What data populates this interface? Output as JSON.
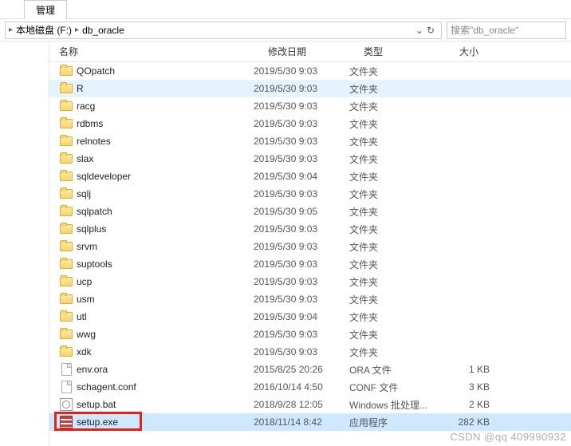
{
  "tab": {
    "label": "管理"
  },
  "breadcrumb": {
    "drive": "本地磁盘 (F:)",
    "folder": "db_oracle"
  },
  "search": {
    "placeholder": "搜索\"db_oracle\""
  },
  "columns": {
    "name": "名称",
    "date": "修改日期",
    "type": "类型",
    "size": "大小"
  },
  "types": {
    "folder": "文件夹",
    "ora": "ORA 文件",
    "conf": "CONF 文件",
    "bat": "Windows 批处理...",
    "exe": "应用程序"
  },
  "files": [
    {
      "icon": "folder",
      "name": "QOpatch",
      "date": "2019/5/30 9:03",
      "type": "文件夹",
      "size": ""
    },
    {
      "icon": "folder",
      "name": "R",
      "date": "2019/5/30 9:03",
      "type": "文件夹",
      "size": "",
      "hover": true
    },
    {
      "icon": "folder",
      "name": "racg",
      "date": "2019/5/30 9:03",
      "type": "文件夹",
      "size": ""
    },
    {
      "icon": "folder",
      "name": "rdbms",
      "date": "2019/5/30 9:03",
      "type": "文件夹",
      "size": ""
    },
    {
      "icon": "folder",
      "name": "relnotes",
      "date": "2019/5/30 9:03",
      "type": "文件夹",
      "size": ""
    },
    {
      "icon": "folder",
      "name": "slax",
      "date": "2019/5/30 9:03",
      "type": "文件夹",
      "size": ""
    },
    {
      "icon": "folder",
      "name": "sqldeveloper",
      "date": "2019/5/30 9:04",
      "type": "文件夹",
      "size": ""
    },
    {
      "icon": "folder",
      "name": "sqlj",
      "date": "2019/5/30 9:03",
      "type": "文件夹",
      "size": ""
    },
    {
      "icon": "folder",
      "name": "sqlpatch",
      "date": "2019/5/30 9:05",
      "type": "文件夹",
      "size": ""
    },
    {
      "icon": "folder",
      "name": "sqlplus",
      "date": "2019/5/30 9:03",
      "type": "文件夹",
      "size": ""
    },
    {
      "icon": "folder",
      "name": "srvm",
      "date": "2019/5/30 9:03",
      "type": "文件夹",
      "size": ""
    },
    {
      "icon": "folder",
      "name": "suptools",
      "date": "2019/5/30 9:03",
      "type": "文件夹",
      "size": ""
    },
    {
      "icon": "folder",
      "name": "ucp",
      "date": "2019/5/30 9:03",
      "type": "文件夹",
      "size": ""
    },
    {
      "icon": "folder",
      "name": "usm",
      "date": "2019/5/30 9:03",
      "type": "文件夹",
      "size": ""
    },
    {
      "icon": "folder",
      "name": "utl",
      "date": "2019/5/30 9:04",
      "type": "文件夹",
      "size": ""
    },
    {
      "icon": "folder",
      "name": "wwg",
      "date": "2019/5/30 9:03",
      "type": "文件夹",
      "size": ""
    },
    {
      "icon": "folder",
      "name": "xdk",
      "date": "2019/5/30 9:03",
      "type": "文件夹",
      "size": ""
    },
    {
      "icon": "file",
      "name": "env.ora",
      "date": "2015/8/25 20:26",
      "type": "ORA 文件",
      "size": "1 KB"
    },
    {
      "icon": "file",
      "name": "schagent.conf",
      "date": "2016/10/14 4:50",
      "type": "CONF 文件",
      "size": "3 KB"
    },
    {
      "icon": "bat",
      "name": "setup.bat",
      "date": "2018/9/28 12:05",
      "type": "Windows 批处理...",
      "size": "2 KB"
    },
    {
      "icon": "exe",
      "name": "setup.exe",
      "date": "2018/11/14 8:42",
      "type": "应用程序",
      "size": "282 KB",
      "selected": true,
      "highlight": true
    }
  ],
  "watermark": "CSDN @qq 409990932"
}
